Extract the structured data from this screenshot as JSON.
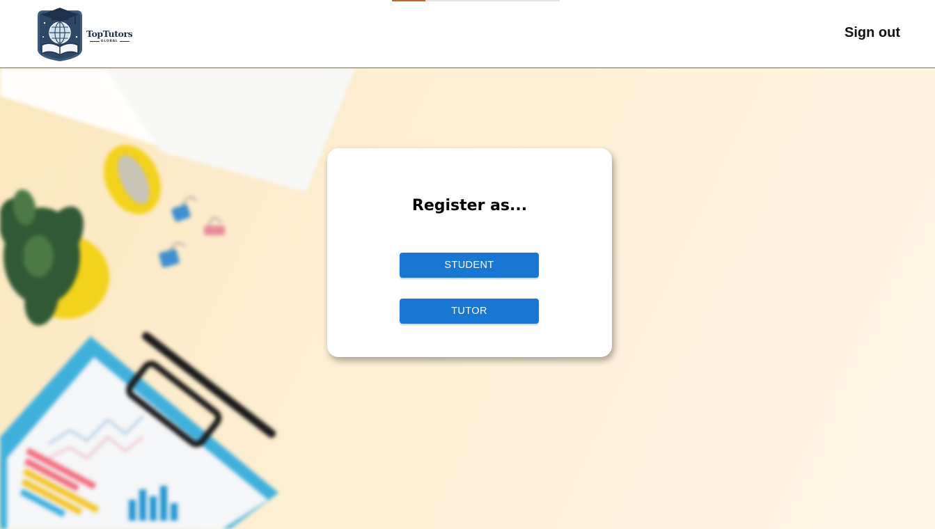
{
  "header": {
    "brand_name": "TopTutors",
    "brand_sub": "GLOBAL",
    "logo_icon": "graduation-cap-globe-book-icon",
    "signout_label": "Sign out"
  },
  "progress": {
    "value": 0.2,
    "color": "#c0662c"
  },
  "background": {
    "description_icon": "desk-scene-background"
  },
  "register_card": {
    "title": "Register as...",
    "student_label": "STUDENT",
    "tutor_label": "TUTOR"
  },
  "colors": {
    "primary_button": "#1976d2",
    "header_bg": "#ffffff",
    "page_bg": "#fdefd2"
  }
}
